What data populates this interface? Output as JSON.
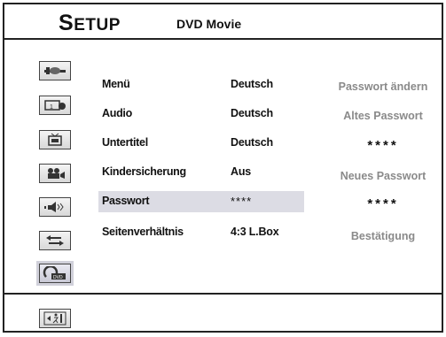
{
  "header": {
    "title_first": "S",
    "title_rest": "ETUP",
    "subtitle": "DVD Movie"
  },
  "sidebar": {
    "icons": [
      {
        "name": "general-setup-icon"
      },
      {
        "name": "clock-setup-icon"
      },
      {
        "name": "tv-setup-icon"
      },
      {
        "name": "video-setup-icon"
      },
      {
        "name": "audio-setup-icon"
      },
      {
        "name": "connection-setup-icon"
      },
      {
        "name": "dvd-setup-icon"
      },
      {
        "name": "exit-icon"
      }
    ]
  },
  "menu": {
    "rows": [
      {
        "label": "Menü",
        "value": "Deutsch"
      },
      {
        "label": "Audio",
        "value": "Deutsch"
      },
      {
        "label": "Untertitel",
        "value": "Deutsch"
      },
      {
        "label": "Kindersicherung",
        "value": "Aus"
      },
      {
        "label": "Passwort",
        "value": "****"
      },
      {
        "label": "Seitenverhältnis",
        "value": "4:3 L.Box"
      }
    ]
  },
  "password_panel": {
    "change_label": "Passwort ändern",
    "old_label": "Altes Passwort",
    "old_value": "****",
    "new_label": "Neues Passwort",
    "new_value": "****",
    "confirm_label": "Bestätigung"
  }
}
